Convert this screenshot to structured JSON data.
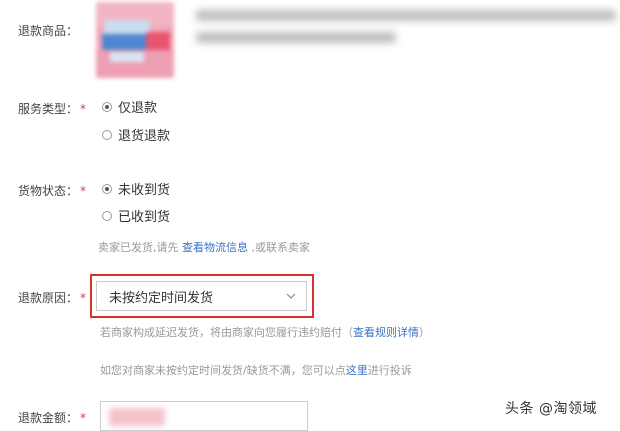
{
  "product": {
    "label": "退款商品：",
    "title_blurred": true
  },
  "service_type": {
    "label": "服务类型：",
    "required_mark": "*",
    "options": [
      {
        "label": "仅退款",
        "selected": true
      },
      {
        "label": "退货退款",
        "selected": false
      }
    ]
  },
  "goods_status": {
    "label": "货物状态：",
    "required_mark": "*",
    "options": [
      {
        "label": "未收到货",
        "selected": true
      },
      {
        "label": "已收到货",
        "selected": false
      }
    ],
    "hint_prefix": "卖家已发货,请先",
    "hint_link": "查看物流信息",
    "hint_suffix": ",或联系卖家"
  },
  "refund_reason": {
    "label": "退款原因：",
    "required_mark": "*",
    "selected_value": "未按约定时间发货",
    "hint1_prefix": "若商家构成延迟发货，将由商家向您履行违约赔付（",
    "hint1_link": "查看规则详情",
    "hint1_suffix": "）",
    "hint2_prefix": "如您对商家未按约定时间发货/缺货不满，您可以点",
    "hint2_link": "这里",
    "hint2_suffix": "进行投诉",
    "highlight_color": "#d9322b"
  },
  "refund_amount": {
    "label": "退款金额：",
    "required_mark": "*",
    "value_blurred": true
  },
  "watermark": {
    "text": "头条 @淘领域"
  },
  "colors": {
    "link": "#3a73c6",
    "required": "#e4393c",
    "hint": "#999999"
  }
}
